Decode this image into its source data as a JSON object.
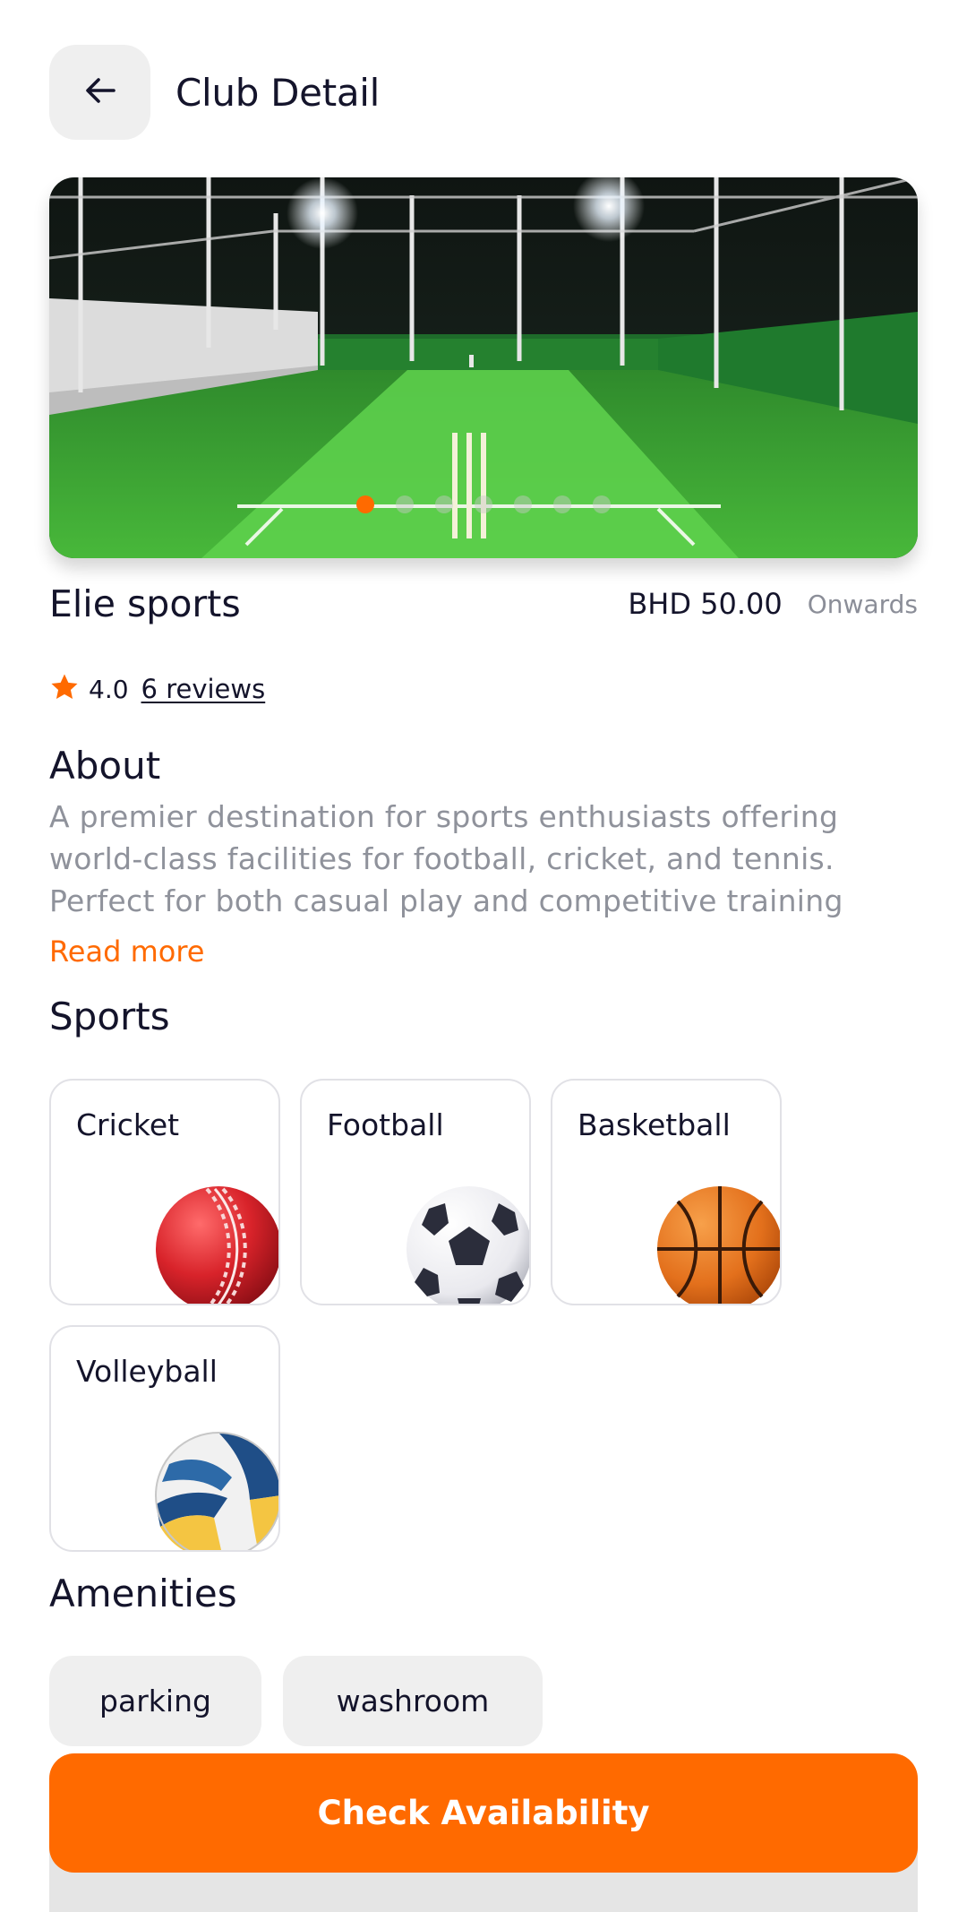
{
  "header": {
    "title": "Club Detail",
    "back_icon": "arrow-left-icon"
  },
  "hero": {
    "slide_count": 7,
    "active_slide": 1
  },
  "club": {
    "name": "Elie sports",
    "price": "BHD 50.00",
    "price_suffix": "Onwards"
  },
  "rating": {
    "value": "4.0",
    "reviews_label": "6 reviews",
    "star_color": "#ff6a00"
  },
  "about": {
    "title": "About",
    "text": "A premier destination for sports enthusiasts offering world-class facilities for football, cricket, and tennis. Perfect for both casual play and competitive training",
    "read_more": "Read more"
  },
  "sports": {
    "title": "Sports",
    "items": [
      {
        "label": "Cricket",
        "icon": "cricket-ball-icon"
      },
      {
        "label": "Football",
        "icon": "football-icon"
      },
      {
        "label": "Basketball",
        "icon": "basketball-icon"
      },
      {
        "label": "Volleyball",
        "icon": "volleyball-icon"
      }
    ]
  },
  "amenities": {
    "title": "Amenities",
    "items": [
      "parking",
      "washroom"
    ]
  },
  "cta": {
    "label": "Check Availability"
  },
  "colors": {
    "accent": "#ff6a00",
    "text": "#14142b",
    "muted": "#8f929b",
    "chip": "#efefef"
  }
}
